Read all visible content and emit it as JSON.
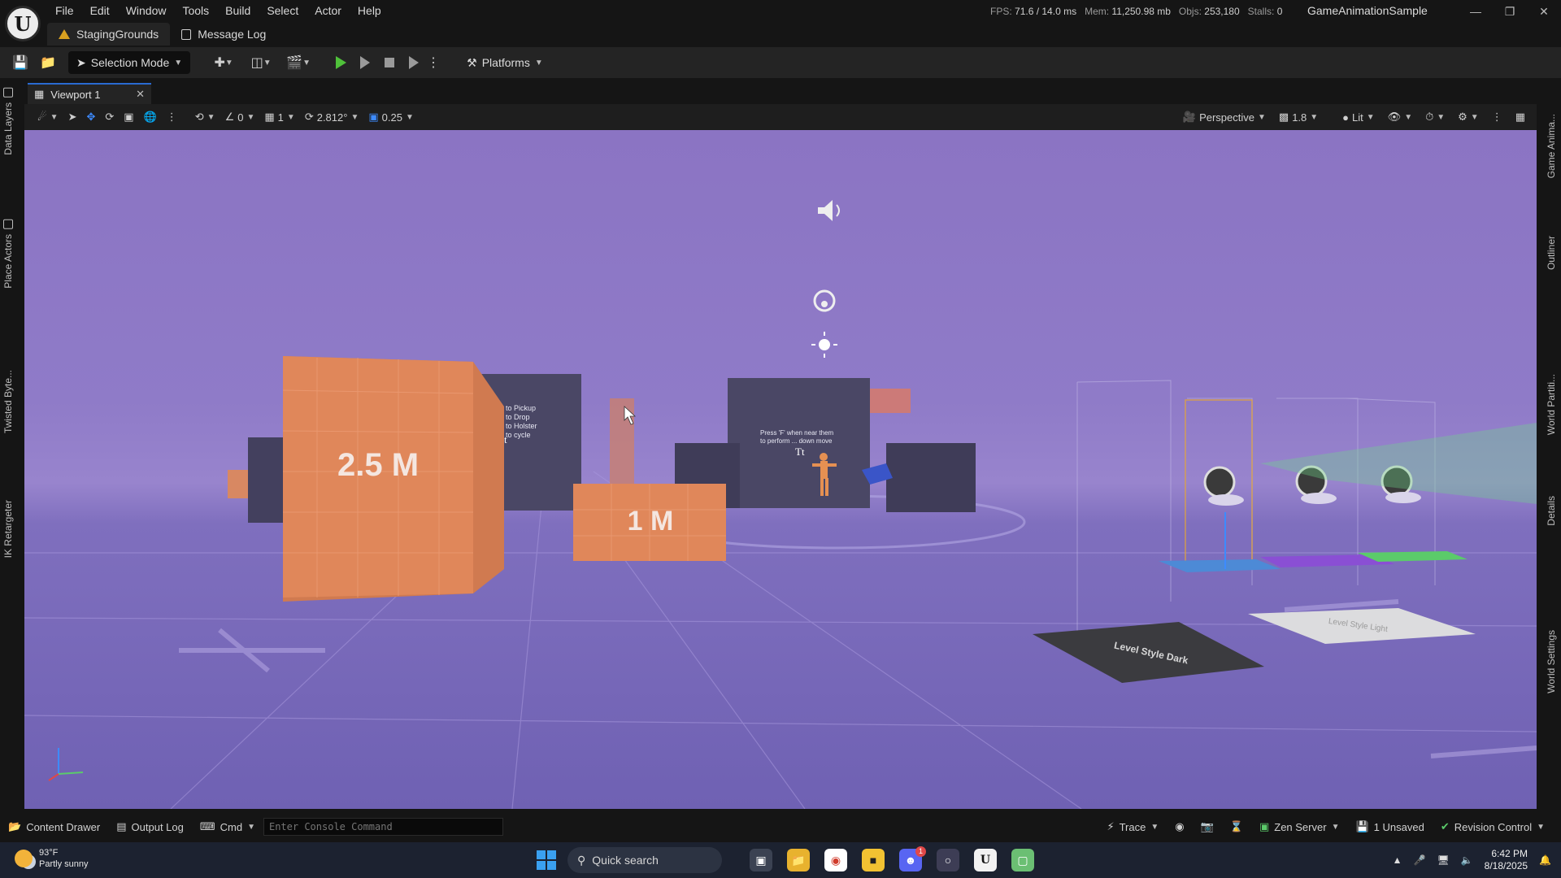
{
  "menu": [
    "File",
    "Edit",
    "Window",
    "Tools",
    "Build",
    "Select",
    "Actor",
    "Help"
  ],
  "stats": {
    "fps_label": "FPS:",
    "fps": "71.6",
    "ms": "/ 14.0 ms",
    "mem_label": "Mem:",
    "mem": "11,250.98 mb",
    "objs_label": "Objs:",
    "objs": "253,180",
    "stalls_label": "Stalls:",
    "stalls": "0"
  },
  "project_name": "GameAnimationSample",
  "tabs": {
    "level": "StagingGrounds",
    "message_log": "Message Log"
  },
  "toolbar": {
    "selection_mode": "Selection Mode",
    "platforms": "Platforms"
  },
  "viewport": {
    "tab_label": "Viewport 1",
    "angle_snap_value": "0",
    "grid_snap_value": "1",
    "rotation_snap": "2.812°",
    "scale_snap": "0.25",
    "view_mode": "Perspective",
    "camera_speed": "1.8",
    "lighting": "Lit"
  },
  "left_tabs": [
    "Data Layers",
    "Place Actors",
    "Twisted Byte...",
    "IK Retargeter"
  ],
  "right_tabs": [
    "Game Anima...",
    "Outliner",
    "World Partiti...",
    "Details",
    "World Settings"
  ],
  "scene": {
    "block_big_label": "2.5 M",
    "block_small_label": "1 M",
    "wall_text_left": [
      "to Pickup",
      "to Drop",
      "to Holster",
      "to cycle"
    ],
    "wall_text_center": [
      "Press 'F' when near them",
      "to perform ... down move"
    ],
    "level_plate_dark": "Level Style Dark",
    "level_plate_light": "Level Style Light",
    "text_actor_glyph": "Tt"
  },
  "statusbar": {
    "content_drawer": "Content Drawer",
    "output_log": "Output Log",
    "cmd": "Cmd",
    "console_placeholder": "Enter Console Command",
    "trace": "Trace",
    "zen_server": "Zen Server",
    "unsaved": "1 Unsaved",
    "revision_control": "Revision Control"
  },
  "taskbar": {
    "temperature": "93°F",
    "weather": "Partly sunny",
    "search": "Quick search",
    "time": "6:42 PM",
    "date": "8/18/2025",
    "notification_count": "1"
  },
  "colors": {
    "accent": "#2a6bd1",
    "play": "#4fc13a",
    "viewport_sky": "#8f7bc8",
    "block_orange": "#e0875a"
  }
}
